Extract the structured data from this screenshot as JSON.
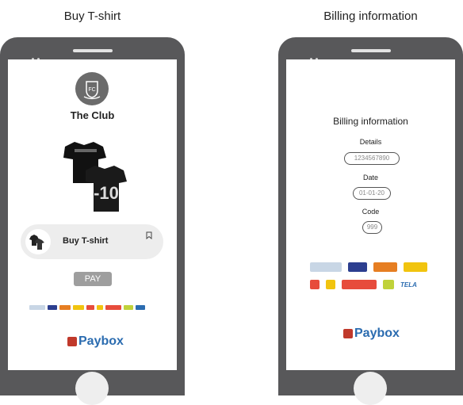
{
  "left_caption": "Buy T-shirt",
  "right_caption": "Billing information",
  "left": {
    "club_name": "The Club",
    "product_label": "Buy T-shirt",
    "pay_button": "PAY",
    "brand": "Paybox"
  },
  "right": {
    "title": "Billing information",
    "details_label": "Details",
    "details_value": "1234567890",
    "date_label": "Date",
    "date_value": "01-01-20",
    "code_label": "Code",
    "code_value": "999",
    "brand": "Paybox",
    "tela": "TELA"
  },
  "colors": {
    "phone": "#58585a",
    "accent": "#2b6cb0",
    "paybox_mark": "#c0392b"
  }
}
